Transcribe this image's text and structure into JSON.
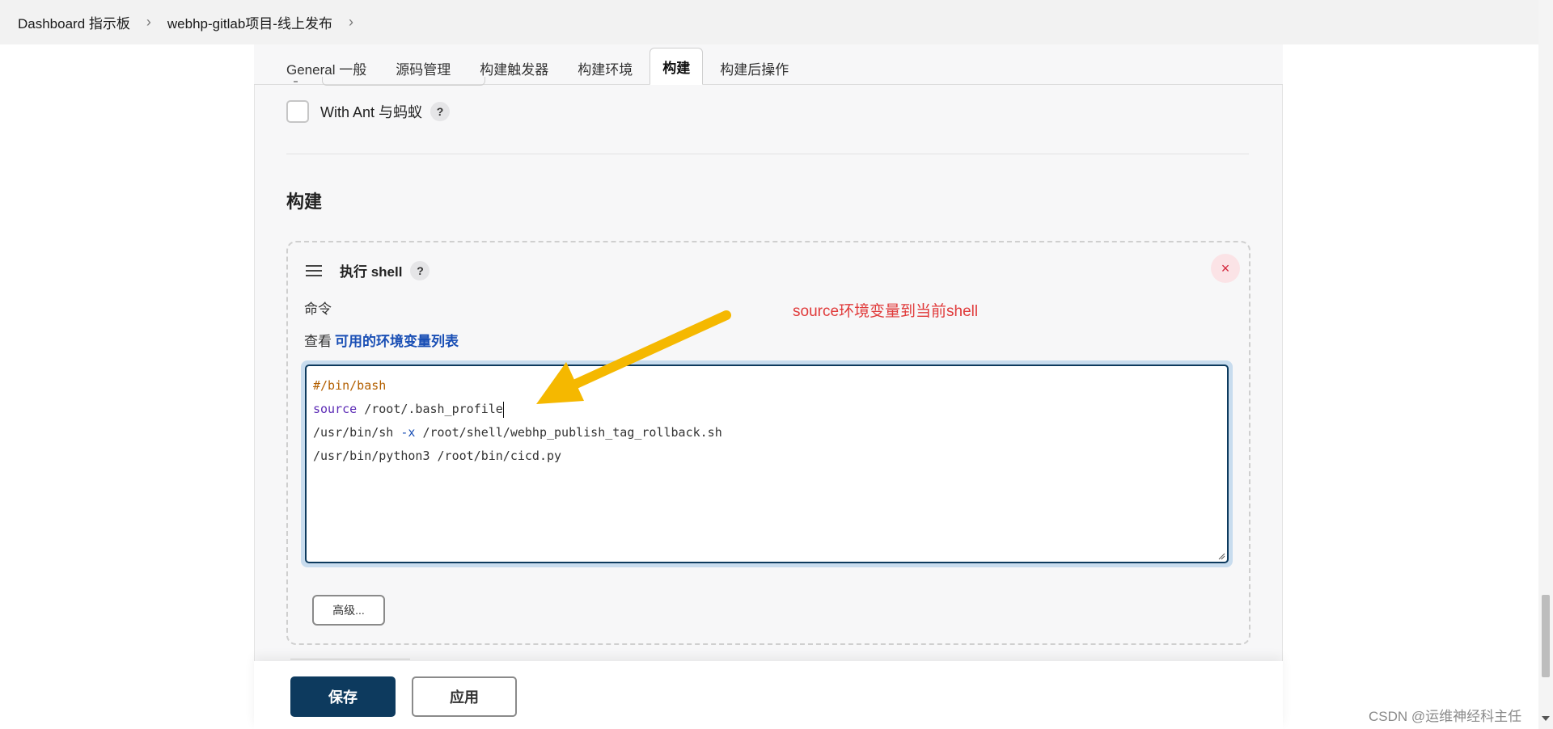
{
  "breadcrumb": {
    "items": [
      "Dashboard 指示板",
      "webhp-gitlab项目-线上发布"
    ],
    "separator": "›"
  },
  "tabs": [
    "General 一般",
    "源码管理",
    "构建触发器",
    "构建环境",
    "构建",
    "构建后操作"
  ],
  "active_tab": "构建",
  "ant": {
    "label": "With Ant 与蚂蚁",
    "help": "?"
  },
  "section": {
    "title": "构建"
  },
  "step": {
    "title": "执行 shell",
    "help": "?",
    "close": "×",
    "command_label": "命令",
    "env_prefix": "查看",
    "env_link": "可用的环境变量列表",
    "code": {
      "line1": "#/bin/bash",
      "line2_kw": "source",
      "line2_rest": " /root/.bash_profile",
      "line3_a": "/usr/bin/sh ",
      "line3_flag": "-x",
      "line3_b": " /root/shell/webhp_publish_tag_rollback.sh",
      "line4": "/usr/bin/python3 /root/bin/cicd.py"
    },
    "advanced": "高级..."
  },
  "annotation": {
    "text": "source环境变量到当前shell",
    "color": "#e03a3a",
    "arrow_color": "#f5b800"
  },
  "footer": {
    "save": "保存",
    "apply": "应用"
  },
  "watermark": "CSDN @运维神经科主任",
  "colors": {
    "primary": "#0d3a5e",
    "link": "#1a4fb5",
    "danger": "#d3243a"
  }
}
